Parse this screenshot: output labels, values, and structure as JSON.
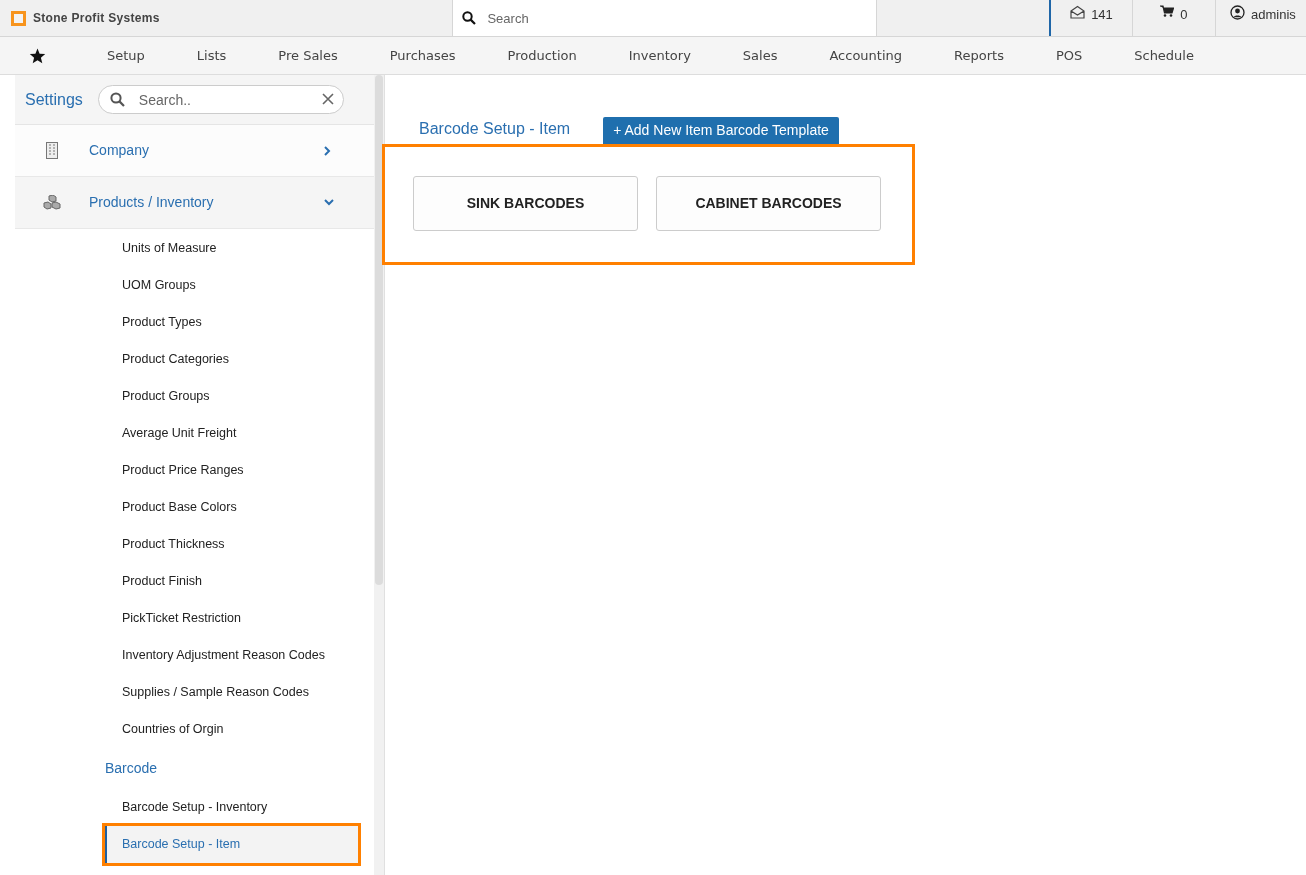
{
  "brand": {
    "name": "Stone Profit Systems"
  },
  "top_search": {
    "placeholder": "Search"
  },
  "header_stats": [
    {
      "kind": "mail",
      "text": "141"
    },
    {
      "kind": "cart",
      "text": "0"
    },
    {
      "kind": "user",
      "text": "adminis"
    }
  ],
  "menu": [
    "Setup",
    "Lists",
    "Pre Sales",
    "Purchases",
    "Production",
    "Inventory",
    "Sales",
    "Accounting",
    "Reports",
    "POS",
    "Schedule"
  ],
  "sidebar": {
    "title": "Settings",
    "search": {
      "placeholder": "Search.."
    },
    "sections": [
      {
        "label": "Company",
        "kind": "building",
        "expanded": false
      },
      {
        "label": "Products / Inventory",
        "kind": "boxes",
        "expanded": true,
        "children": [
          {
            "kind": "link",
            "label": "Units of Measure",
            "selected": false
          },
          {
            "kind": "link",
            "label": "UOM Groups",
            "selected": false
          },
          {
            "kind": "link",
            "label": "Product Types",
            "selected": false
          },
          {
            "kind": "link",
            "label": "Product Categories",
            "selected": false
          },
          {
            "kind": "link",
            "label": "Product Groups",
            "selected": false
          },
          {
            "kind": "link",
            "label": "Average Unit Freight",
            "selected": false
          },
          {
            "kind": "link",
            "label": "Product Price Ranges",
            "selected": false
          },
          {
            "kind": "link",
            "label": "Product Base Colors",
            "selected": false
          },
          {
            "kind": "link",
            "label": "Product Thickness",
            "selected": false
          },
          {
            "kind": "link",
            "label": "Product Finish",
            "selected": false
          },
          {
            "kind": "link",
            "label": "PickTicket Restriction",
            "selected": false
          },
          {
            "kind": "link",
            "label": "Inventory Adjustment Reason Codes",
            "selected": false
          },
          {
            "kind": "link",
            "label": "Supplies / Sample Reason Codes",
            "selected": false
          },
          {
            "kind": "link",
            "label": "Countries of Orgin",
            "selected": false
          },
          {
            "kind": "group",
            "label": "Barcode",
            "children": [
              {
                "kind": "link",
                "label": "Barcode Setup - Inventory",
                "selected": false
              },
              {
                "kind": "link",
                "label": "Barcode Setup - Item",
                "selected": true
              }
            ]
          }
        ]
      }
    ]
  },
  "main": {
    "title": "Barcode Setup - Item",
    "add_button": "+ Add New Item Barcode Template",
    "templates": [
      "SINK BARCODES",
      "CABINET BARCODES"
    ]
  }
}
